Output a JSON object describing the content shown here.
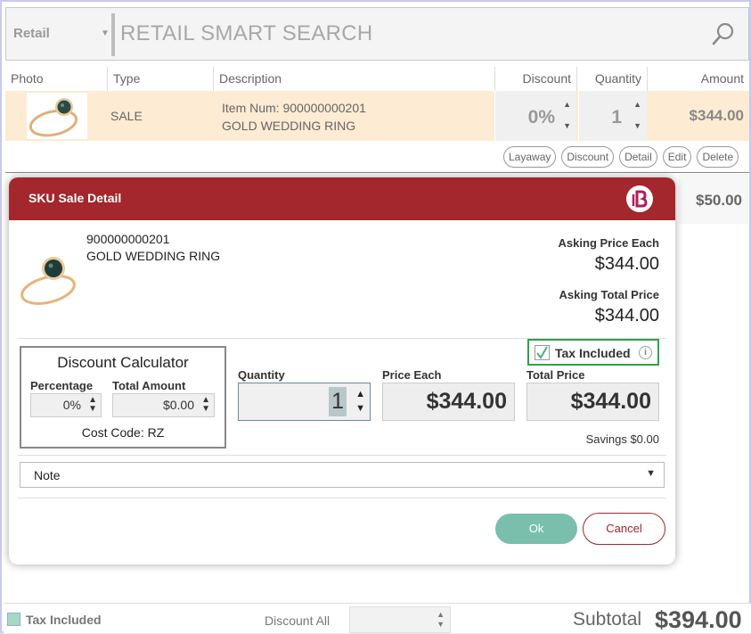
{
  "search": {
    "category": "Retail",
    "placeholder": "RETAIL SMART SEARCH"
  },
  "table": {
    "headers": [
      "Photo",
      "Type",
      "Description",
      "Discount",
      "Quantity",
      "Amount"
    ],
    "row": {
      "type": "SALE",
      "item_num": "Item Num: 900000000201",
      "description": "GOLD WEDDING RING",
      "discount": "0%",
      "quantity": "1",
      "amount": "$344.00"
    },
    "actions": [
      "Layaway",
      "Discount",
      "Detail",
      "Edit",
      "Delete"
    ],
    "row2_amount": "$50.00"
  },
  "footer": {
    "tax_included": "Tax Included",
    "discount_all": "Discount All",
    "subtotal_label": "Subtotal",
    "subtotal_value": "$394.00"
  },
  "modal": {
    "title": "SKU Sale Detail",
    "sku": "900000000201",
    "description": "GOLD WEDDING RING",
    "asking_each_label": "Asking Price Each",
    "asking_each_value": "$344.00",
    "asking_total_label": "Asking Total Price",
    "asking_total_value": "$344.00",
    "tax_included_label": "Tax Included",
    "tax_included_checked": true,
    "calc": {
      "title": "Discount Calculator",
      "percentage_label": "Percentage",
      "percentage_value": "0%",
      "total_amount_label": "Total Amount",
      "total_amount_value": "$0.00",
      "cost_code": "Cost Code: RZ"
    },
    "quantity_label": "Quantity",
    "quantity_value": "1",
    "price_each_label": "Price Each",
    "price_each_value": "$344.00",
    "total_price_label": "Total Price",
    "total_price_value": "$344.00",
    "savings": "Savings  $0.00",
    "note_label": "Note",
    "ok_label": "Ok",
    "cancel_label": "Cancel"
  },
  "colors": {
    "header_red": "#a3272c",
    "ok_green": "#79bfab",
    "tax_highlight": "#2fa24a",
    "row_highlight": "#fdebd3"
  },
  "icons": [
    "search-icon",
    "chevron-down-icon",
    "brand-logo-icon",
    "check-icon",
    "info-icon",
    "ring-photo"
  ]
}
